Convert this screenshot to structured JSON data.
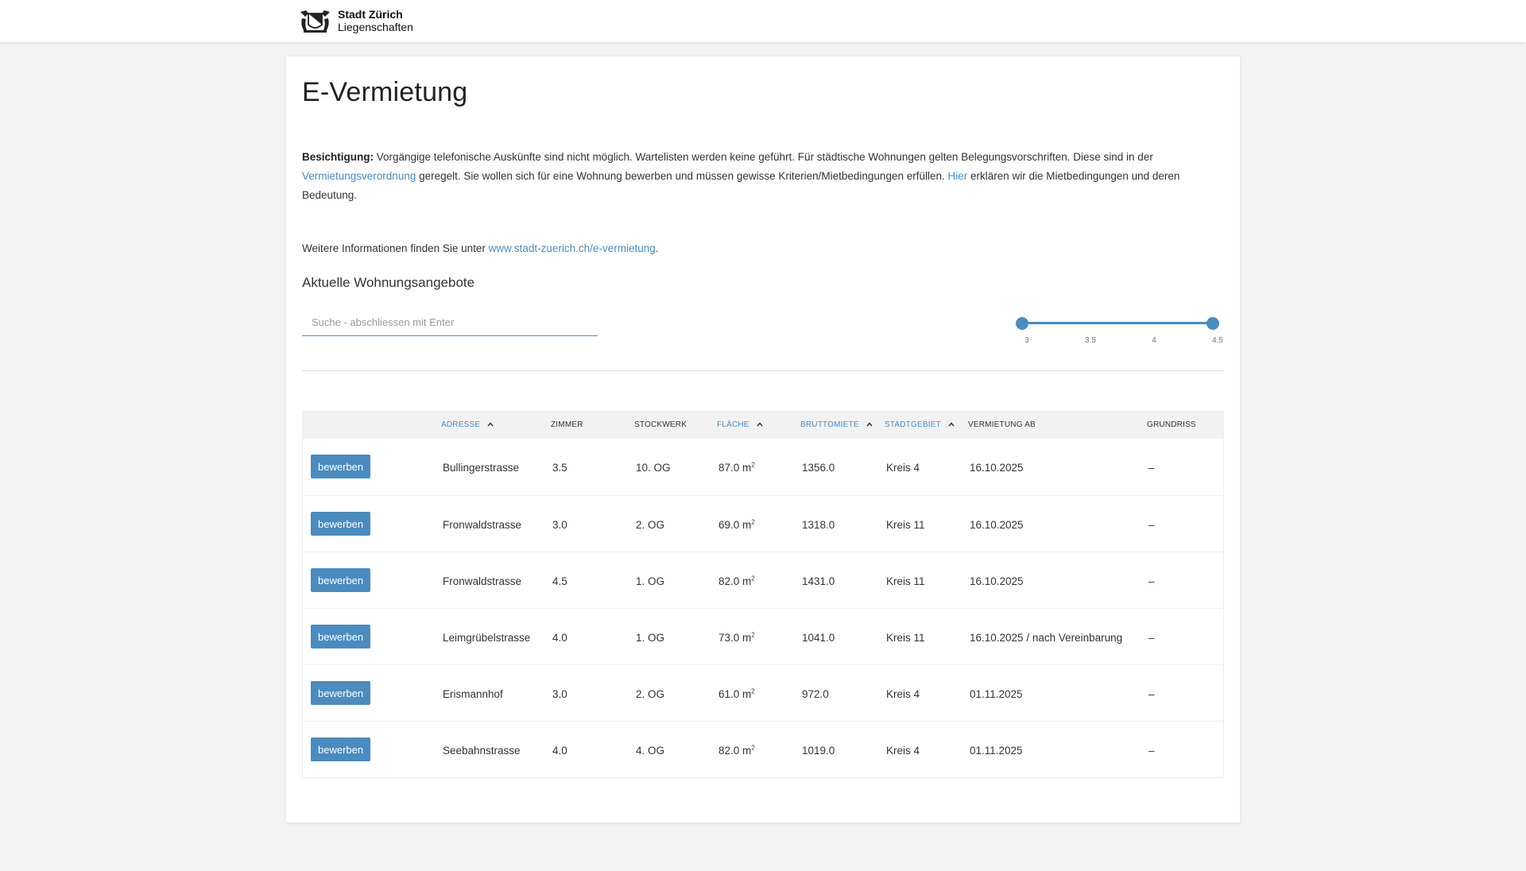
{
  "header": {
    "logo_title": "Stadt Zürich",
    "logo_subtitle": "Liegenschaften"
  },
  "page": {
    "title": "E-Vermietung",
    "intro_bold": "Besichtigung:",
    "intro_text1": " Vorgängige telefonische Auskünfte sind nicht möglich. Wartelisten werden keine geführt. Für städtische Wohnungen gelten Belegungsvorschriften. Diese sind in der ",
    "intro_link1": "Vermietungsverordnung",
    "intro_text2": " geregelt. Sie wollen sich für eine Wohnung bewerben und müssen gewisse Kriterien/Mietbedingungen erfüllen. ",
    "intro_link2": "Hier",
    "intro_text3": " erklären wir die Mietbedingungen und deren Bedeutung.",
    "more_prefix": "Weitere Informationen finden Sie unter ",
    "more_link": "www.stadt-zuerich.ch/e-vermietung",
    "more_suffix": ".",
    "section_title": "Aktuelle Wohnungsangebote"
  },
  "search": {
    "placeholder": "Suche - abschliessen mit Enter",
    "value": ""
  },
  "room_slider": {
    "min": 3,
    "max": 4.5,
    "selected_low": 3,
    "selected_high": 4.5,
    "ticks": [
      "3",
      "3.5",
      "4",
      "4.5"
    ],
    "accent": "#4b8bbe"
  },
  "table": {
    "headers": {
      "adresse": "Adresse",
      "zimmer": "Zimmer",
      "stockwerk": "Stockwerk",
      "flaeche": "Fläche",
      "bruttomiete": "Bruttomiete",
      "stadtgebiet": "Stadtgebiet",
      "vermietung_ab": "Vermietung ab",
      "grundriss": "Grundriss"
    },
    "rows": [
      {
        "button": "bewerben",
        "adresse": "Bullingerstrasse",
        "zimmer": "3.5",
        "stockwerk": "10. OG",
        "flaeche": "87.0 m",
        "bruttomiete": "1356.0",
        "stadtgebiet": "Kreis 4",
        "vermietung_ab": "16.10.2025",
        "grundriss": "–"
      },
      {
        "button": "bewerben",
        "adresse": "Fronwaldstrasse",
        "zimmer": "3.0",
        "stockwerk": "2. OG",
        "flaeche": "69.0 m",
        "bruttomiete": "1318.0",
        "stadtgebiet": "Kreis 11",
        "vermietung_ab": "16.10.2025",
        "grundriss": "–"
      },
      {
        "button": "bewerben",
        "adresse": "Fronwaldstrasse",
        "zimmer": "4.5",
        "stockwerk": "1. OG",
        "flaeche": "82.0 m",
        "bruttomiete": "1431.0",
        "stadtgebiet": "Kreis 11",
        "vermietung_ab": "16.10.2025",
        "grundriss": "–"
      },
      {
        "button": "bewerben",
        "adresse": "Leimgrübelstrasse",
        "zimmer": "4.0",
        "stockwerk": "1. OG",
        "flaeche": "73.0 m",
        "bruttomiete": "1041.0",
        "stadtgebiet": "Kreis 11",
        "vermietung_ab": "16.10.2025 / nach Vereinbarung",
        "grundriss": "–"
      },
      {
        "button": "bewerben",
        "adresse": "Erismannhof",
        "zimmer": "3.0",
        "stockwerk": "2. OG",
        "flaeche": "61.0 m",
        "bruttomiete": "972.0",
        "stadtgebiet": "Kreis 4",
        "vermietung_ab": "01.11.2025",
        "grundriss": "–"
      },
      {
        "button": "bewerben",
        "adresse": "Seebahnstrasse",
        "zimmer": "4.0",
        "stockwerk": "4. OG",
        "flaeche": "82.0 m",
        "bruttomiete": "1019.0",
        "stadtgebiet": "Kreis 4",
        "vermietung_ab": "01.11.2025",
        "grundriss": "–"
      }
    ],
    "area_unit_superscript": "2"
  }
}
